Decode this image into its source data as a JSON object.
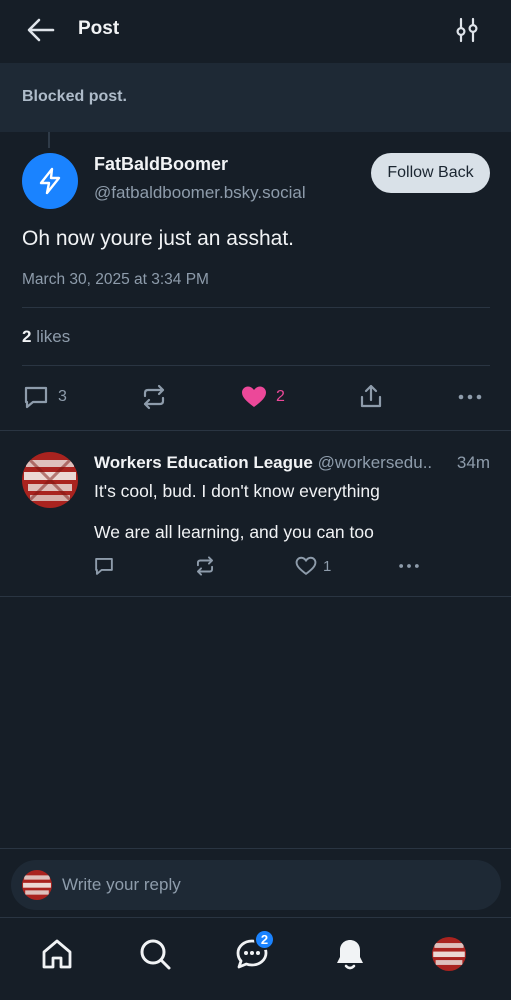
{
  "header": {
    "title": "Post",
    "back_icon": "arrow-left-icon",
    "filter_icon": "sliders-icon"
  },
  "blocked_notice": "Blocked post.",
  "post": {
    "author_name": "FatBaldBoomer",
    "author_handle": "@fatbaldboomer.bsky.social",
    "follow_button": "Follow Back",
    "text": "Oh now youre just an asshat.",
    "timestamp": "March 30, 2025 at 3:34 PM",
    "likes_count": "2",
    "likes_label": " likes",
    "actions": {
      "replies": "3",
      "likes": "2"
    }
  },
  "reply": {
    "author_name": "Workers Education League",
    "author_handle": " @workersedu..",
    "time": "34m",
    "line1": "It's cool, bud. I don't know everything",
    "line2": "We are all learning, and you can too",
    "likes": "1"
  },
  "composer": {
    "placeholder": "Write your reply"
  },
  "tabbar": {
    "chat_badge": "2"
  },
  "colors": {
    "background": "#161e27",
    "accent": "#1a83ff",
    "like": "#ec4899"
  }
}
